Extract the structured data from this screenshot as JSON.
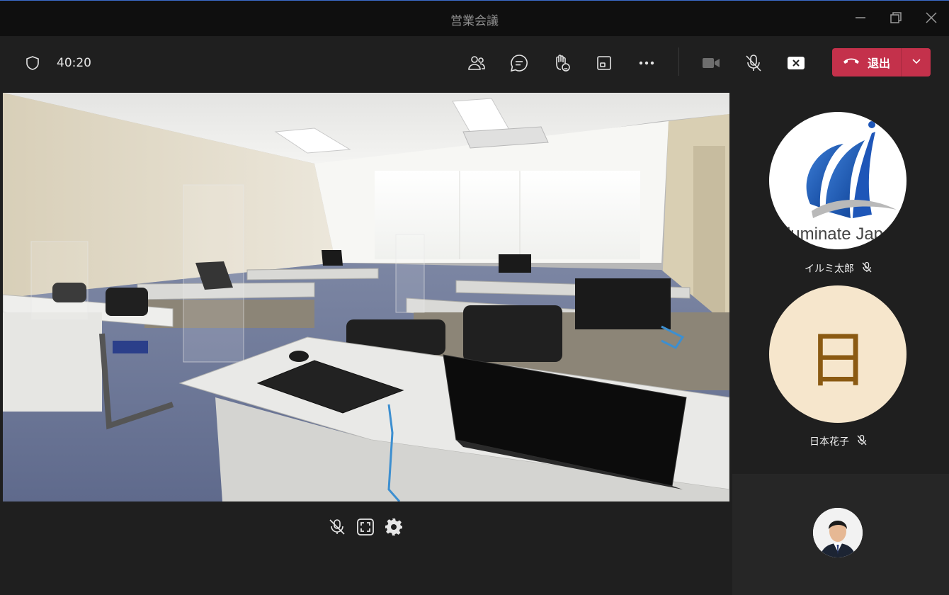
{
  "window": {
    "title": "営業会議"
  },
  "toolbar": {
    "timer": "40:20",
    "leave_label": "退出",
    "icons": [
      "people-icon",
      "chat-icon",
      "raise-hand-icon",
      "share-tray-icon",
      "more-icon",
      "camera-off-icon",
      "mic-off-icon",
      "share-stop-icon"
    ]
  },
  "participants": [
    {
      "name": "イルミ太郎",
      "muted": true,
      "avatar": "logo",
      "logo_text": "lluminate Japa"
    },
    {
      "name": "日本花子",
      "muted": true,
      "avatar": "initial",
      "initial": "日"
    }
  ],
  "colors": {
    "accent_leave": "#c4314b",
    "avatar_bg": "#f6e6cc",
    "avatar_fg": "#8b5a12"
  }
}
